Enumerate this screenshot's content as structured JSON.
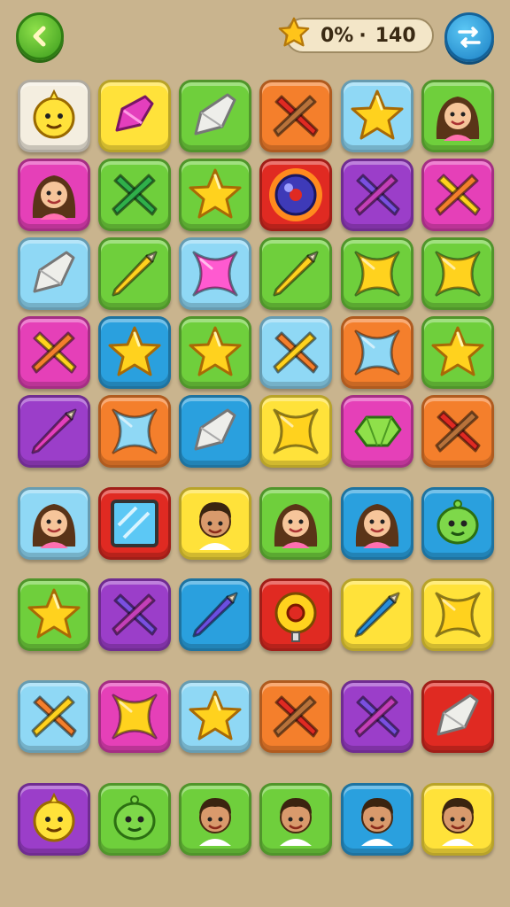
{
  "hud": {
    "progress_text": "0%",
    "separator": "·",
    "score": "140",
    "back_icon": "chevron-left-icon",
    "menu_icon": "arrows-shuffle-icon",
    "star_icon": "star-icon"
  },
  "colors": {
    "cream": "#f4eee0",
    "yellow": "#ffe23a",
    "green": "#6fcf3c",
    "orange": "#f47f2c",
    "lblue": "#8fd8f5",
    "purple": "#9b3ec9",
    "magenta": "#e540b8",
    "blue": "#2aa0de",
    "red": "#e02a22"
  },
  "board": [
    [
      {
        "color": "cream",
        "icon": "yellow-creature"
      },
      {
        "color": "yellow",
        "icon": "magenta-gem"
      },
      {
        "color": "green",
        "icon": "white-gem"
      },
      {
        "color": "orange",
        "icon": "crossed-crayons"
      },
      {
        "color": "lblue",
        "icon": "star"
      },
      {
        "color": "green",
        "icon": "girl-face"
      }
    ],
    [
      {
        "color": "magenta",
        "icon": "girl-face"
      },
      {
        "color": "green",
        "icon": "crossed-crayons"
      },
      {
        "color": "green",
        "icon": "star"
      },
      {
        "color": "red",
        "icon": "bomb-orb"
      },
      {
        "color": "purple",
        "icon": "crossed-crayons"
      },
      {
        "color": "magenta",
        "icon": "crossed-crayons"
      }
    ],
    [
      {
        "color": "lblue",
        "icon": "white-gem"
      },
      {
        "color": "green",
        "icon": "crayon"
      },
      {
        "color": "lblue",
        "icon": "x-star"
      },
      {
        "color": "green",
        "icon": "crayon"
      },
      {
        "color": "green",
        "icon": "x-star"
      },
      {
        "color": "green",
        "icon": "x-star"
      }
    ],
    [
      {
        "color": "magenta",
        "icon": "crossed-crayons"
      },
      {
        "color": "blue",
        "icon": "star"
      },
      {
        "color": "green",
        "icon": "star"
      },
      {
        "color": "lblue",
        "icon": "crossed-crayons"
      },
      {
        "color": "orange",
        "icon": "x-star"
      },
      {
        "color": "green",
        "icon": "star"
      }
    ],
    [
      {
        "color": "purple",
        "icon": "crayon"
      },
      {
        "color": "orange",
        "icon": "x-star"
      },
      {
        "color": "blue",
        "icon": "white-gem"
      },
      {
        "color": "yellow",
        "icon": "x-star"
      },
      {
        "color": "magenta",
        "icon": "green-gem"
      },
      {
        "color": "orange",
        "icon": "crossed-crayons"
      }
    ],
    [
      {
        "color": "lblue",
        "icon": "girl-face"
      },
      {
        "color": "red",
        "icon": "mirror-square"
      },
      {
        "color": "yellow",
        "icon": "boy-face"
      },
      {
        "color": "green",
        "icon": "girl-face"
      },
      {
        "color": "blue",
        "icon": "girl-face"
      },
      {
        "color": "blue",
        "icon": "green-creature"
      }
    ],
    [
      {
        "color": "green",
        "icon": "star"
      },
      {
        "color": "purple",
        "icon": "crossed-crayons"
      },
      {
        "color": "blue",
        "icon": "crayon"
      },
      {
        "color": "red",
        "icon": "donut-ring"
      },
      {
        "color": "yellow",
        "icon": "crayon"
      },
      {
        "color": "yellow",
        "icon": "x-star"
      }
    ],
    [
      {
        "color": "lblue",
        "icon": "crossed-crayons"
      },
      {
        "color": "magenta",
        "icon": "x-star"
      },
      {
        "color": "lblue",
        "icon": "star"
      },
      {
        "color": "orange",
        "icon": "crossed-crayons"
      },
      {
        "color": "purple",
        "icon": "crossed-crayons"
      },
      {
        "color": "red",
        "icon": "white-gem"
      }
    ],
    [
      {
        "color": "purple",
        "icon": "yellow-creature"
      },
      {
        "color": "green",
        "icon": "green-creature"
      },
      {
        "color": "green",
        "icon": "boy-face"
      },
      {
        "color": "green",
        "icon": "boy-face"
      },
      {
        "color": "blue",
        "icon": "boy-face"
      },
      {
        "color": "yellow",
        "icon": "boy-face"
      }
    ]
  ]
}
